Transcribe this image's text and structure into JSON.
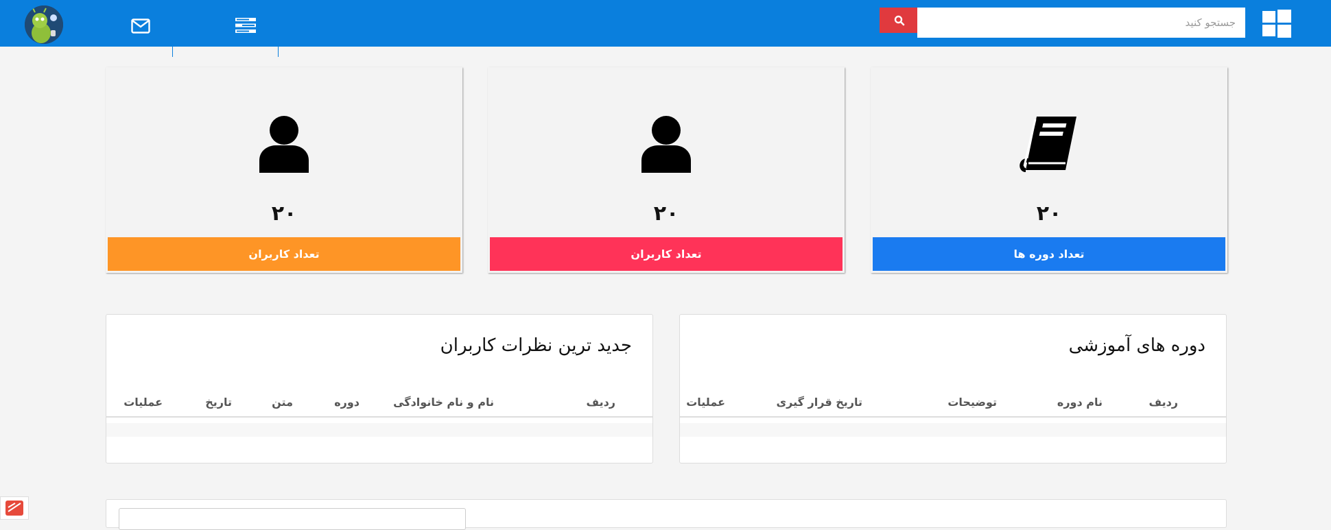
{
  "header": {
    "search_placeholder": "جستجو کنید",
    "icons": [
      "windows-icon",
      "search-icon",
      "menu-icon",
      "mail-icon",
      "avatar"
    ]
  },
  "stats": [
    {
      "value": "۲۰",
      "label": "تعداد دوره ها",
      "color": "#1a7bf0",
      "icon": "book-icon"
    },
    {
      "value": "۲۰",
      "label": "تعداد کاربران",
      "color": "#ff3358",
      "icon": "user-icon"
    },
    {
      "value": "۲۰",
      "label": "تعداد کاربران",
      "color": "#fe9526",
      "icon": "user-icon"
    }
  ],
  "courses_table": {
    "title": "دوره های آموزشی",
    "columns": [
      "ردیف",
      "نام دوره",
      "توضیحات",
      "تاریخ قرار گیری",
      "عملیات"
    ]
  },
  "comments_table": {
    "title": "جدید ترین نظرات کاربران",
    "columns": [
      "ردیف",
      "نام و نام خانوادگی",
      "دوره",
      "متن",
      "تاریخ",
      "عملیات"
    ]
  }
}
